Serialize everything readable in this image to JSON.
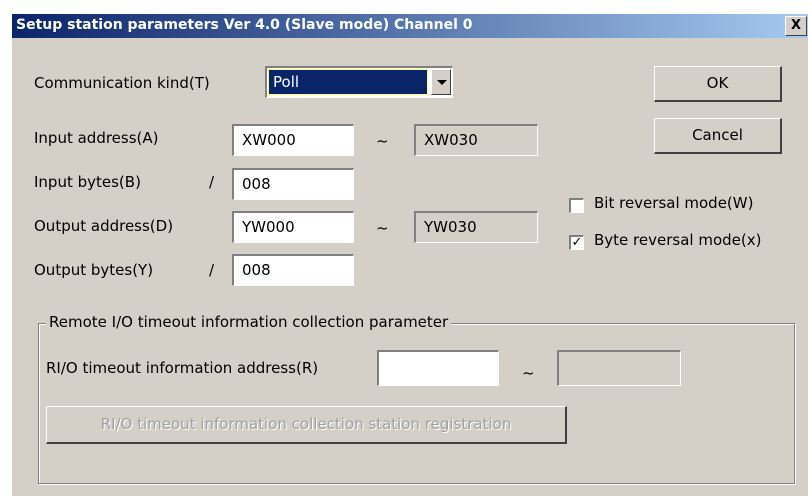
{
  "window": {
    "title": "Setup station parameters Ver 4.0 (Slave mode) Channel 0",
    "close_label": "X"
  },
  "communication": {
    "label": "Communication kind(T)",
    "value": "Poll"
  },
  "input_address": {
    "label": "Input address(A)",
    "start": "XW000",
    "separator": "~",
    "end": "XW030"
  },
  "input_bytes": {
    "label": "Input bytes(B)",
    "slash": "/",
    "value": "008"
  },
  "output_address": {
    "label": "Output address(D)",
    "start": "YW000",
    "separator": "~",
    "end": "YW030"
  },
  "output_bytes": {
    "label": "Output bytes(Y)",
    "slash": "/",
    "value": "008"
  },
  "buttons": {
    "ok": "OK",
    "cancel": "Cancel"
  },
  "options": {
    "bit_reversal": {
      "label": "Bit reversal mode(W)",
      "checked": false,
      "mark": ""
    },
    "byte_reversal": {
      "label": "Byte reversal mode(x)",
      "checked": true,
      "mark": "✓"
    }
  },
  "remote_io": {
    "group_title": "Remote I/O timeout information collection parameter",
    "address_label": "RI/O timeout information address(R)",
    "start": "",
    "separator": "~",
    "end": "",
    "registration_button": "RI/O timeout information collection station registration"
  }
}
